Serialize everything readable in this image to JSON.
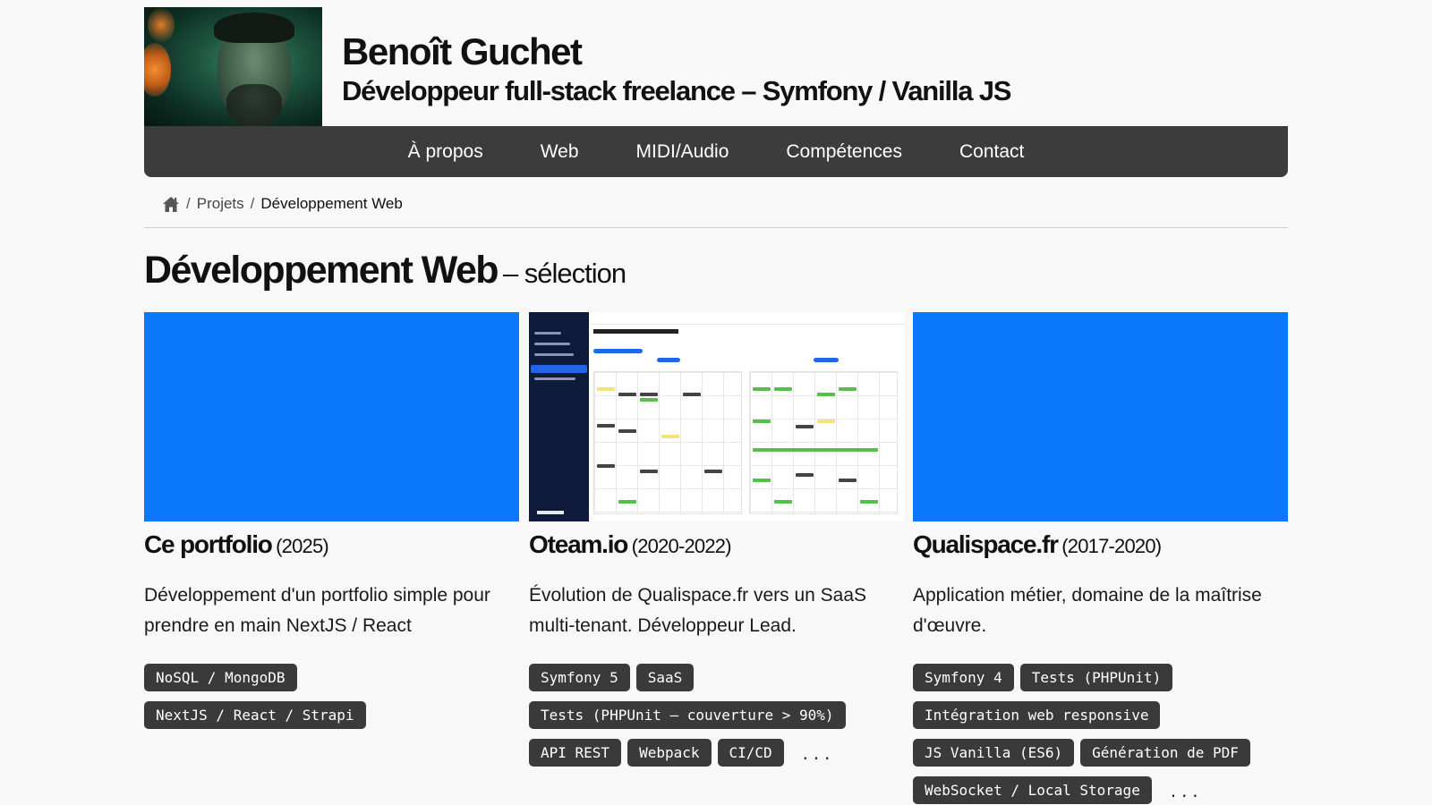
{
  "header": {
    "name": "Benoît Guchet",
    "subtitle": "Développeur full-stack freelance – Symfony / Vanilla JS"
  },
  "nav": {
    "items": [
      "À propos",
      "Web",
      "MIDI/Audio",
      "Compétences",
      "Contact"
    ]
  },
  "breadcrumb": {
    "home_icon": "home-icon",
    "separator": "/",
    "items": [
      "Projets",
      "Développement Web"
    ]
  },
  "page": {
    "title": "Développement Web",
    "title_suffix": "– sélection"
  },
  "colors": {
    "accent_blue": "#0b77fb",
    "nav_bg": "#3c3c3c",
    "tag_bg": "#3a3a3a"
  },
  "projects": [
    {
      "name": "Ce portfolio",
      "years": "(2025)",
      "description": "Développement d'un portfolio simple pour prendre en main NextJS / React",
      "tags": [
        "NoSQL / MongoDB",
        "NextJS / React / Strapi"
      ],
      "more": ""
    },
    {
      "name": "Oteam.io",
      "years": "(2020-2022)",
      "description": "Évolution de Qualispace.fr vers un SaaS multi-tenant. Développeur Lead.",
      "tags": [
        "Symfony 5",
        "SaaS",
        "Tests (PHPUnit – couverture > 90%)",
        "API REST",
        "Webpack",
        "CI/CD"
      ],
      "more": "..."
    },
    {
      "name": "Qualispace.fr",
      "years": "(2017-2020)",
      "description": "Application métier, domaine de la maîtrise d'œuvre.",
      "tags": [
        "Symfony 4",
        "Tests (PHPUnit)",
        "Intégration web responsive",
        "JS Vanilla (ES6)",
        "Génération de PDF",
        "WebSocket / Local Storage"
      ],
      "more": "..."
    }
  ]
}
